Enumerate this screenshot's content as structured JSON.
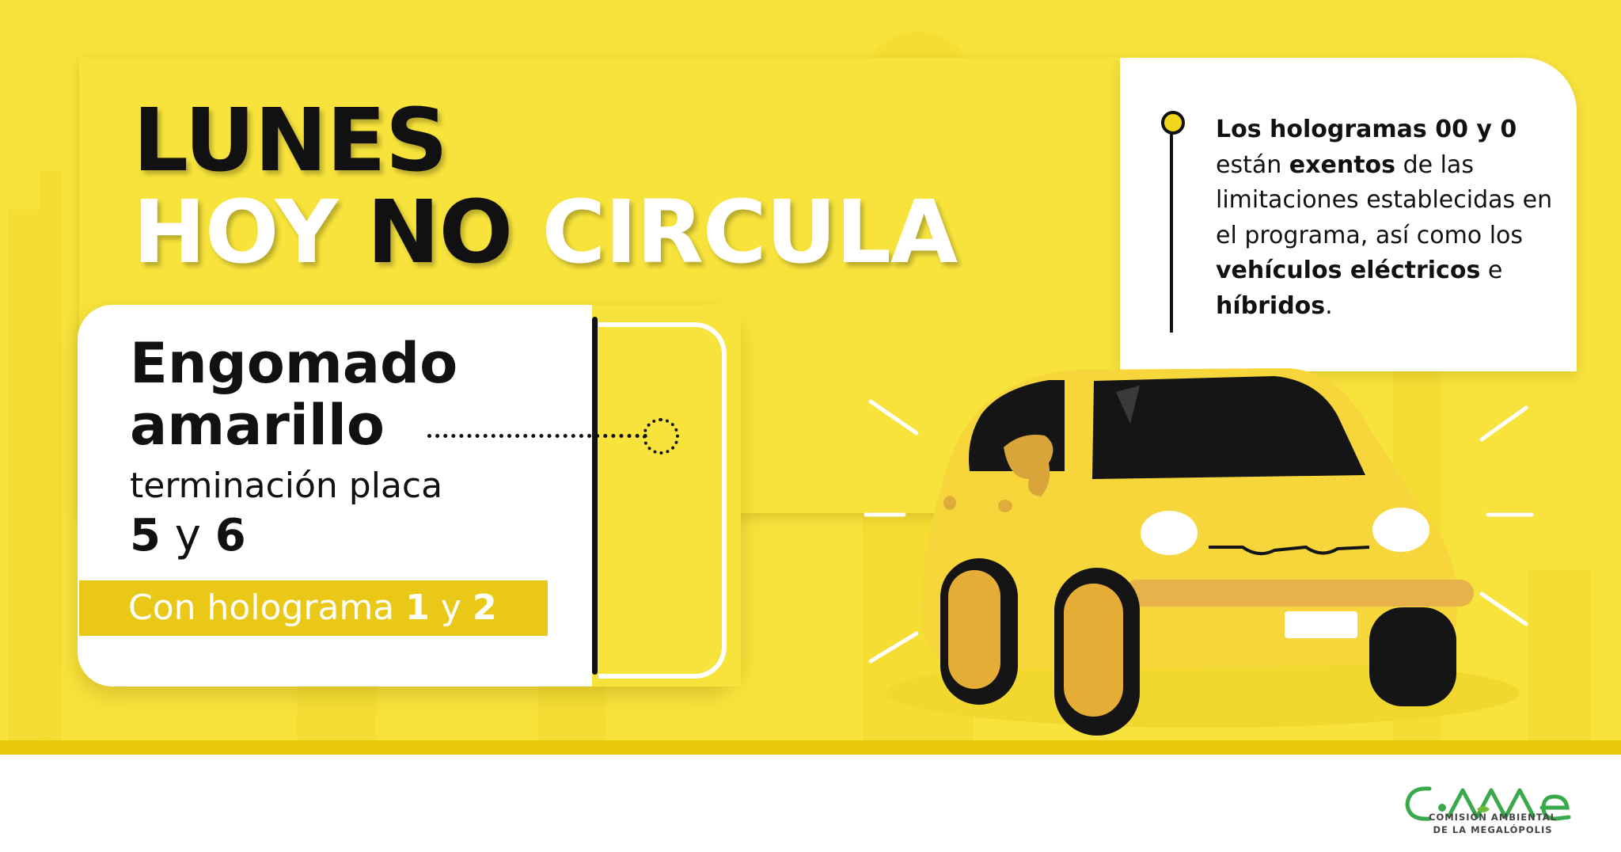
{
  "header": {
    "day": "LUNES",
    "title_hoy": "HOY",
    "title_no": "NO",
    "title_circula": "CIRCULA"
  },
  "sticker": {
    "title_line1": "Engomado",
    "title_line2": "amarillo",
    "plate_label": "terminación placa",
    "plate_first": "5",
    "plate_connector": "y",
    "plate_second": "6",
    "hologram_prefix": "Con holograma",
    "hologram_first": "1",
    "hologram_connector": "y",
    "hologram_second": "2",
    "color": "#f8e23c"
  },
  "note": {
    "bold1": "Los hologramas 00 y 0",
    "text1": "están",
    "bold2": "exentos",
    "text2": "de las limitaciones establecidas en el programa, así como los",
    "bold3": "vehículos eléctricos",
    "text3": "e",
    "bold4": "híbridos",
    "text4": "."
  },
  "logo": {
    "wordmark": "CAMe",
    "subtitle_line1": "COMISIÓN AMBIENTAL",
    "subtitle_line2": "DE LA MEGALÓPOLIS"
  },
  "colors": {
    "background": "#f8e23c",
    "text_dark": "#111111",
    "hologram_bar": "#e9c818",
    "car_body": "#f5d43a",
    "logo_green": "#3aa94b"
  },
  "icons": [
    "car-illustration",
    "sticker-dotted-connector-icon",
    "note-pin-icon"
  ]
}
